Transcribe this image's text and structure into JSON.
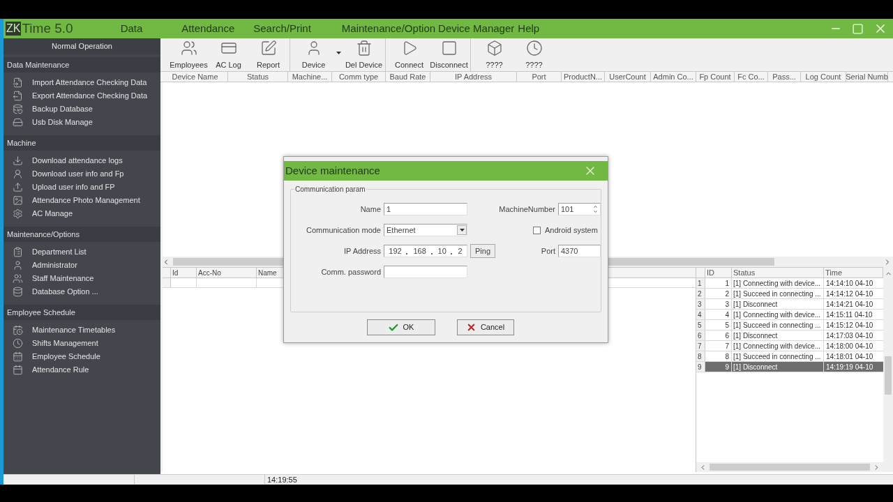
{
  "app": {
    "logo_mark": "ZK",
    "logo_text": "Time 5.0"
  },
  "menu": [
    "Data",
    "Attendance",
    "Search/Print",
    "Maintenance/Option",
    "Device Manager",
    "Help"
  ],
  "sidebar": {
    "title": "Normal Operation",
    "sections": [
      {
        "title": "Data Maintenance",
        "items": [
          "Import Attendance Checking Data",
          "Export Attendance Checking Data",
          "Backup Database",
          "Usb Disk Manage"
        ]
      },
      {
        "title": "Machine",
        "items": [
          "Download attendance logs",
          "Download user info and Fp",
          "Upload user info and FP",
          "Attendance Photo Management",
          "AC Manage"
        ]
      },
      {
        "title": "Maintenance/Options",
        "items": [
          "Department List",
          "Administrator",
          "Staff Maintenance",
          "Database Option ..."
        ]
      },
      {
        "title": "Employee Schedule",
        "items": [
          "Maintenance Timetables",
          "Shifts Management",
          "Employee Schedule",
          "Attendance Rule"
        ]
      }
    ]
  },
  "toolbar_groups": [
    {
      "buttons": [
        {
          "label": "Employees",
          "kind": "button"
        },
        {
          "label": "AC Log",
          "kind": "button"
        },
        {
          "label": "Report",
          "kind": "button"
        }
      ]
    },
    {
      "buttons": [
        {
          "label": "Device",
          "kind": "dropdown"
        },
        {
          "label": "Del Device",
          "kind": "button"
        }
      ]
    },
    {
      "buttons": [
        {
          "label": "Connect",
          "kind": "button"
        },
        {
          "label": "Disconnect",
          "kind": "button"
        }
      ]
    },
    {
      "buttons": [
        {
          "label": "????",
          "kind": "button"
        },
        {
          "label": "????",
          "kind": "button"
        }
      ]
    }
  ],
  "device_table": {
    "columns": [
      "Device Name",
      "Status",
      "Machine...",
      "Comm type",
      "Baud Rate",
      "IP Address",
      "Port",
      "ProductN...",
      "UserCount",
      "Admin Co...",
      "Fp Count",
      "Fc Co...",
      "Pass...",
      "Log Count",
      "Serial Numb"
    ]
  },
  "user_table": {
    "columns": [
      "Id",
      "Acc-No",
      "Name"
    ]
  },
  "log_table": {
    "columns": [
      "ID",
      "Status",
      "Time"
    ],
    "rows": [
      {
        "row_header": "1",
        "id": "1",
        "status": "[1] Connecting with device...",
        "time": "14:14:10 04-10",
        "selected": false
      },
      {
        "row_header": "2",
        "id": "2",
        "status": "[1] Succeed in connecting ...",
        "time": "14:14:12 04-10",
        "selected": false
      },
      {
        "row_header": "3",
        "id": "3",
        "status": "[1] Disconnect",
        "time": "14:14:21 04-10",
        "selected": false
      },
      {
        "row_header": "4",
        "id": "4",
        "status": "[1] Connecting with device...",
        "time": "14:15:11 04-10",
        "selected": false
      },
      {
        "row_header": "5",
        "id": "5",
        "status": "[1] Succeed in connecting ...",
        "time": "14:15:12 04-10",
        "selected": false
      },
      {
        "row_header": "6",
        "id": "6",
        "status": "[1] Disconnect",
        "time": "14:17:03 04-10",
        "selected": false
      },
      {
        "row_header": "7",
        "id": "7",
        "status": "[1] Connecting with device...",
        "time": "14:18:00 04-10",
        "selected": false
      },
      {
        "row_header": "8",
        "id": "8",
        "status": "[1] Succeed in connecting ...",
        "time": "14:18:01 04-10",
        "selected": false
      },
      {
        "row_header": "9",
        "id": "9",
        "status": "[1] Disconnect",
        "time": "14:19:19 04-10",
        "selected": true
      }
    ]
  },
  "status_bar": {
    "time": "14:19:55"
  },
  "dialog": {
    "title": "Device maintenance",
    "group": "Communication param",
    "name": {
      "label": "Name",
      "value": "1"
    },
    "machine_number": {
      "label": "MachineNumber",
      "value": "101"
    },
    "comm_mode": {
      "label": "Communication mode",
      "value": "Ethernet"
    },
    "android": {
      "label": "Android system",
      "checked": false
    },
    "ip": {
      "label": "IP Address",
      "octets": [
        "192",
        "168",
        "10",
        "2"
      ]
    },
    "ping": "Ping",
    "port": {
      "label": "Port",
      "value": "4370"
    },
    "password": {
      "label": "Comm. password"
    },
    "ok": "OK",
    "cancel": "Cancel"
  }
}
